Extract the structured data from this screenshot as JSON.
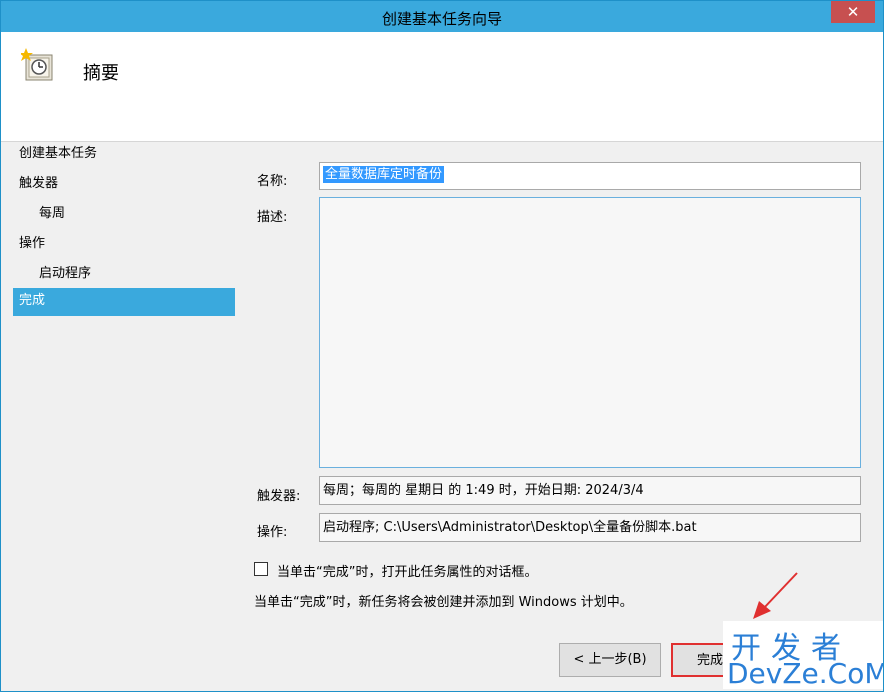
{
  "window": {
    "title": "创建基本任务向导",
    "close_label": "✕"
  },
  "header": {
    "title": "摘要"
  },
  "sidebar": {
    "items": [
      {
        "label": "创建基本任务"
      },
      {
        "label": "触发器"
      },
      {
        "label": "每周"
      },
      {
        "label": "操作"
      },
      {
        "label": "启动程序"
      },
      {
        "label": "完成"
      }
    ]
  },
  "form": {
    "name_label": "名称:",
    "name_value": "全量数据库定时备份",
    "desc_label": "描述:",
    "desc_value": "",
    "trigger_label": "触发器:",
    "trigger_value": "每周；每周的 星期日 的 1:49 时，开始日期: 2024/3/4",
    "action_label": "操作:",
    "action_value": "启动程序; C:\\Users\\Administrator\\Desktop\\全量备份脚本.bat",
    "checkbox_label": "当单击“完成”时，打开此任务属性的对话框。",
    "checkbox_checked": false,
    "info_text": "当单击“完成”时，新任务将会被创建并添加到 Windows 计划中。"
  },
  "buttons": {
    "back_label": "< 上一步(B)",
    "finish_label": "完成"
  },
  "watermark": {
    "top": "开发者",
    "bottom": "DevZe.CoM"
  },
  "colors": {
    "titlebar": "#3aa9dd",
    "close": "#c75050",
    "selected": "#3aa9dd",
    "highlight": "#e03030"
  }
}
